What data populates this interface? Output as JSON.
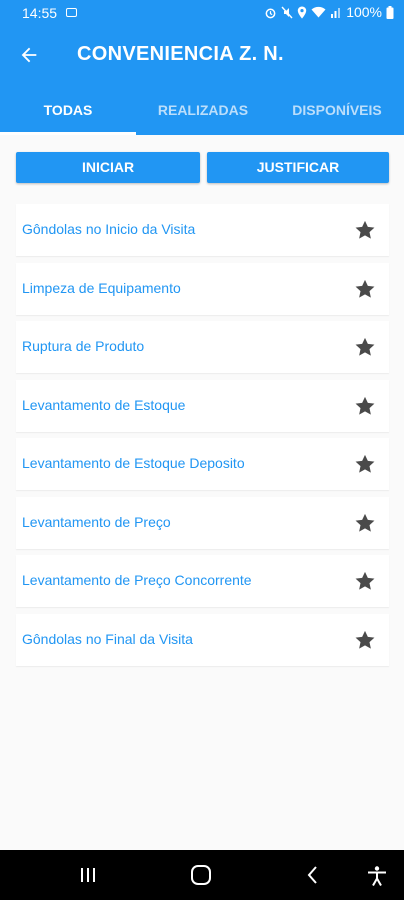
{
  "status_bar": {
    "time": "14:55",
    "battery": "100%",
    "icons": [
      "image-icon",
      "alarm-icon",
      "mute-icon",
      "location-icon",
      "wifi-icon",
      "signal-icon",
      "battery-icon"
    ]
  },
  "app_bar": {
    "title": "CONVENIENCIA Z. N.",
    "color": "#2196f3"
  },
  "tabs": [
    {
      "label": "TODAS",
      "active": true
    },
    {
      "label": "REALIZADAS",
      "active": false
    },
    {
      "label": "DISPONÍVEIS",
      "active": false
    }
  ],
  "actions": {
    "start_label": "INICIAR",
    "justify_label": "JUSTIFICAR"
  },
  "tasks": [
    {
      "label": "Gôndolas no Inicio da Visita"
    },
    {
      "label": "Limpeza de Equipamento"
    },
    {
      "label": "Ruptura de Produto"
    },
    {
      "label": "Levantamento de Estoque"
    },
    {
      "label": "Levantamento de Estoque Deposito"
    },
    {
      "label": "Levantamento de Preço"
    },
    {
      "label": "Levantamento de Preço Concorrente"
    },
    {
      "label": "Gôndolas no Final da Visita"
    }
  ],
  "nav_bar": {
    "icons": [
      "recent-apps-icon",
      "home-icon",
      "back-nav-icon",
      "accessibility-icon"
    ]
  }
}
